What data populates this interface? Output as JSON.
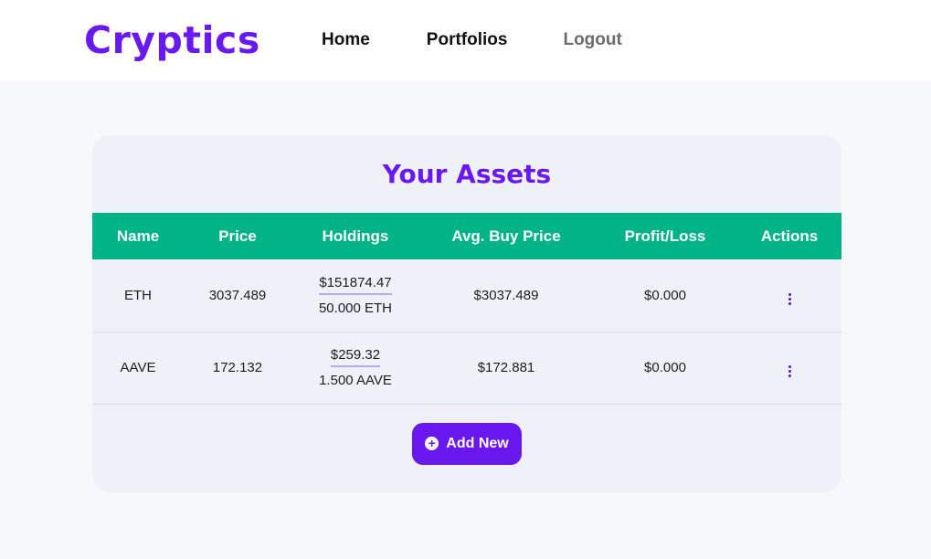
{
  "app": {
    "logo": "Cryptics"
  },
  "nav": {
    "home": "Home",
    "portfolios": "Portfolios",
    "logout": "Logout"
  },
  "assets": {
    "title": "Your Assets",
    "columns": [
      "Name",
      "Price",
      "Holdings",
      "Avg. Buy Price",
      "Profit/Loss",
      "Actions"
    ],
    "rows": [
      {
        "name": "ETH",
        "price": "3037.489",
        "holdings_usd": "$151874.47",
        "holdings_qty": "50.000 ETH",
        "avg_buy": "$3037.489",
        "profit_loss": "$0.000"
      },
      {
        "name": "AAVE",
        "price": "172.132",
        "holdings_usd": "$259.32",
        "holdings_qty": "1.500 AAVE",
        "avg_buy": "$172.881",
        "profit_loss": "$0.000"
      }
    ],
    "add_button": "Add New"
  },
  "icons": {
    "actions": "more-vertical-icon",
    "add": "plus-circle-icon"
  },
  "colors": {
    "brand": "#6a18f0",
    "header_green": "#01b487"
  }
}
